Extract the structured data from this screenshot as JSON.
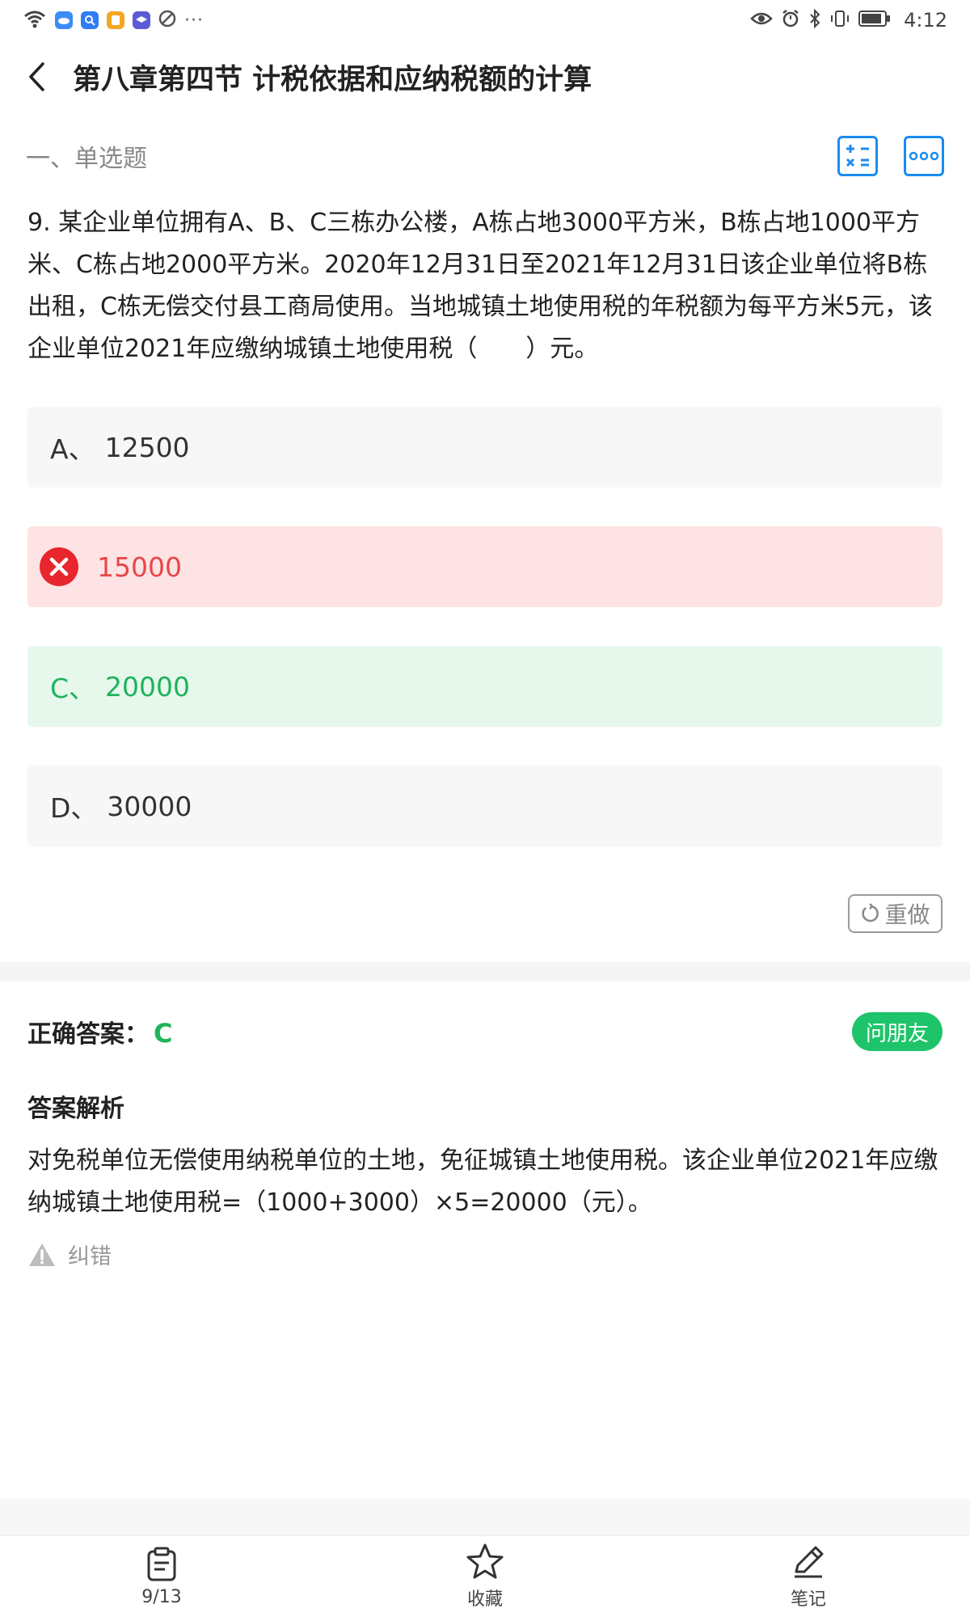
{
  "status_bar": {
    "time": "4:12",
    "more": "···",
    "left_icons": [
      "wifi-icon",
      "cloud-app-icon",
      "search-app-icon",
      "note-app-icon",
      "school-app-icon",
      "vpn-app-icon"
    ],
    "right_icons": [
      "eye-comfort-icon",
      "alarm-icon",
      "bluetooth-icon",
      "vibrate-icon",
      "battery-icon"
    ]
  },
  "header": {
    "title": "第八章第四节 计税依据和应纳税额的计算"
  },
  "section": {
    "label": "一、单选题",
    "tools": [
      "calculator-icon",
      "more-options-icon"
    ]
  },
  "question": {
    "text": "9. 某企业单位拥有A、B、C三栋办公楼，A栋占地3000平方米，B栋占地1000平方米、C栋占地2000平方米。2020年12月31日至2021年12月31日该企业单位将B栋出租，C栋无偿交付县工商局使用。当地城镇土地使用税的年税额为每平方米5元，该企业单位2021年应缴纳城镇土地使用税（　　）元。"
  },
  "options": [
    {
      "letter": "A、",
      "value": "12500",
      "state": "normal"
    },
    {
      "letter": "",
      "value": "15000",
      "state": "wrong"
    },
    {
      "letter": "C、",
      "value": "20000",
      "state": "correct"
    },
    {
      "letter": "D、",
      "value": "30000",
      "state": "normal"
    }
  ],
  "redo_label": "重做",
  "answer": {
    "label": "正确答案：",
    "value": "C",
    "ask_friend": "问朋友"
  },
  "analysis": {
    "title": "答案解析",
    "text": "对免税单位无偿使用纳税单位的土地，免征城镇土地使用税。该企业单位2021年应缴纳城镇土地使用税=（1000+3000）×5=20000（元）。",
    "report_label": "纠错"
  },
  "bottom_nav": {
    "progress": "9/13",
    "favorite": "收藏",
    "notes": "笔记"
  },
  "colors": {
    "accent_blue": "#1a8cf0",
    "correct_green": "#1fb35a",
    "wrong_red": "#e8464b",
    "ask_button": "#1ec46a"
  }
}
